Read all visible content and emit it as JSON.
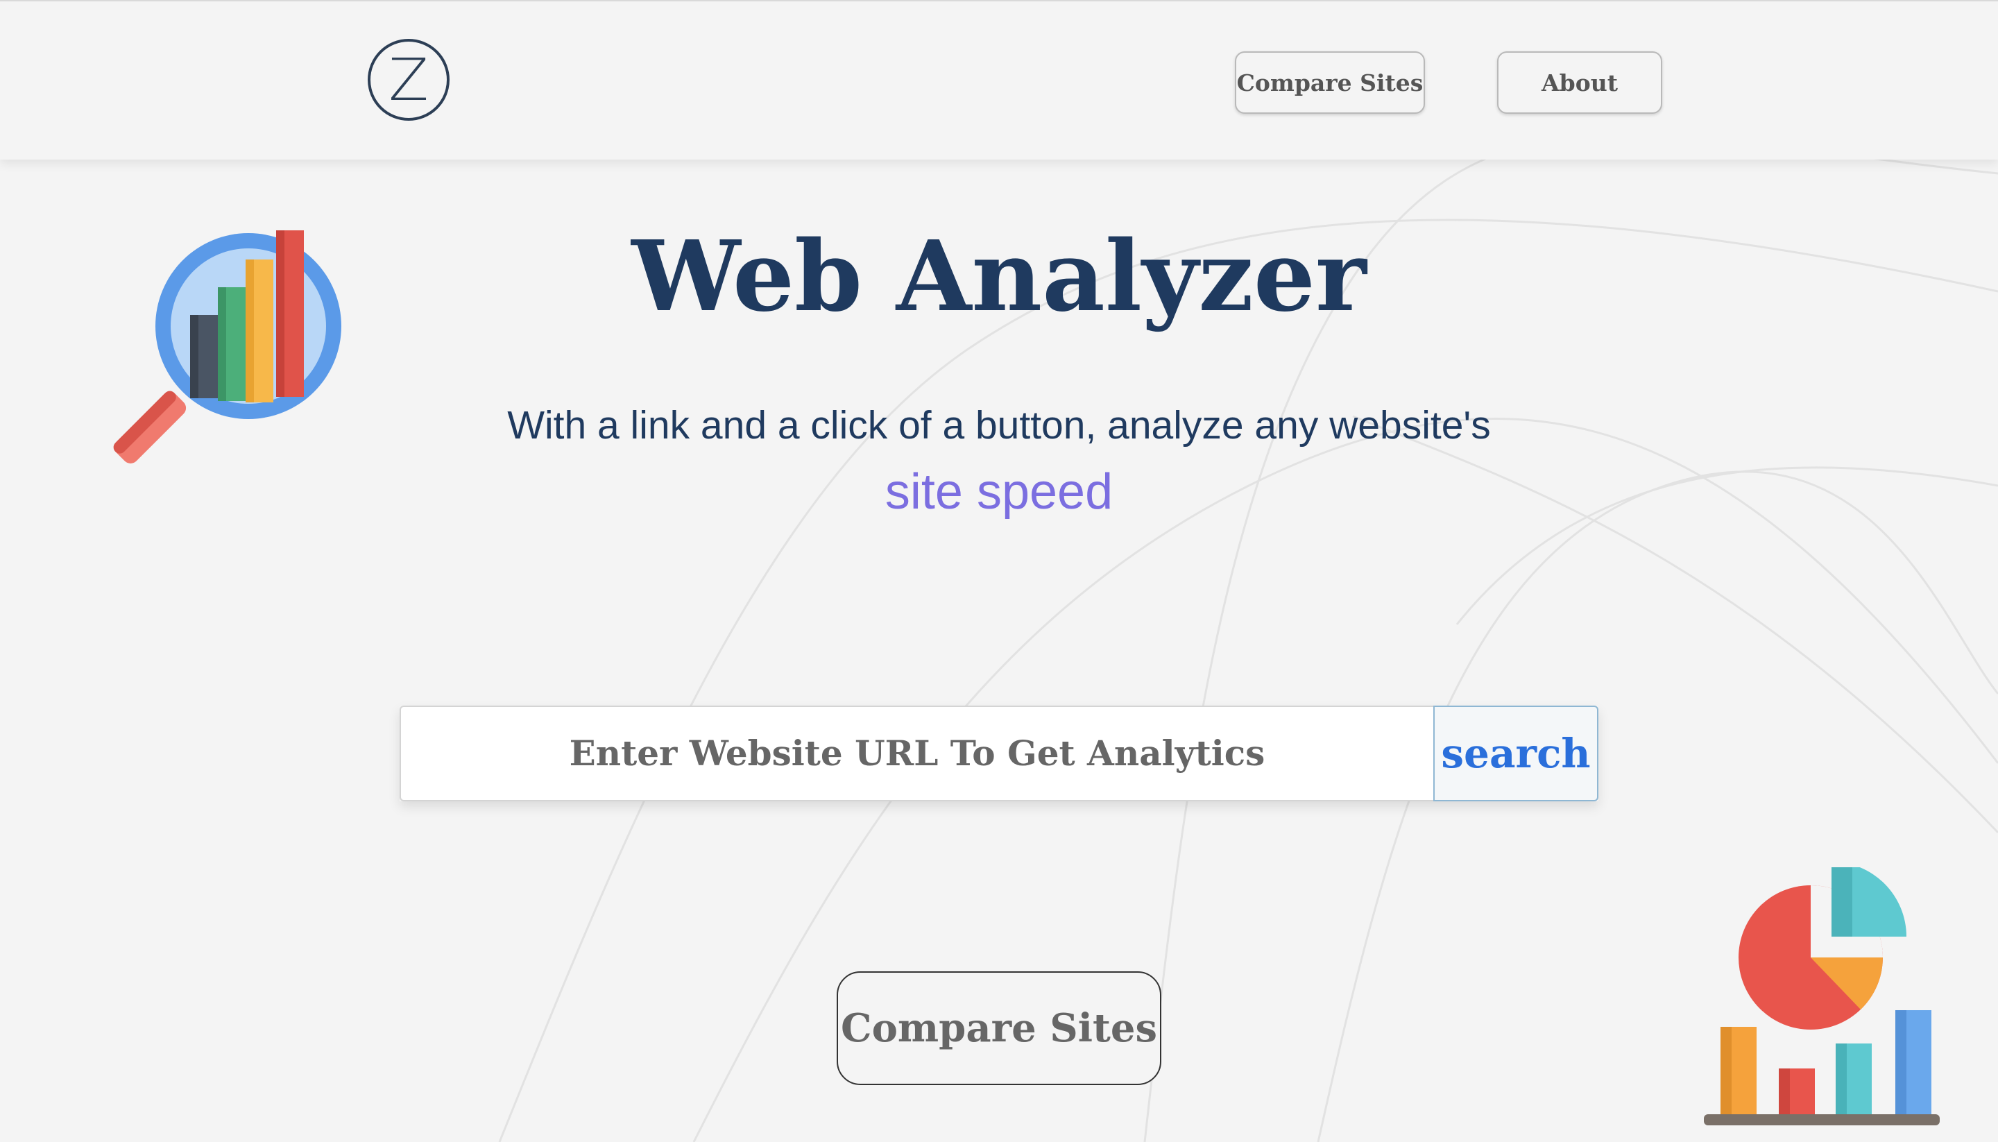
{
  "header": {
    "logo_letter": "Z",
    "nav": {
      "compare_label": "Compare Sites",
      "about_label": "About"
    }
  },
  "hero": {
    "title": "Web Analyzer",
    "subtitle": "With a link and a click of a button, analyze any website's",
    "rotating_word": "site speed"
  },
  "search": {
    "placeholder": "Enter Website URL To Get Analytics",
    "value": "",
    "button_label": "search"
  },
  "cta": {
    "compare_label": "Compare Sites"
  },
  "icons": {
    "hero": "magnifier-bar-chart-icon",
    "corner": "pie-bar-chart-icon"
  },
  "colors": {
    "title": "#1f3a5f",
    "accent": "#7b6ee0",
    "search_button_text": "#2a6fdb",
    "background": "#f4f4f4"
  }
}
